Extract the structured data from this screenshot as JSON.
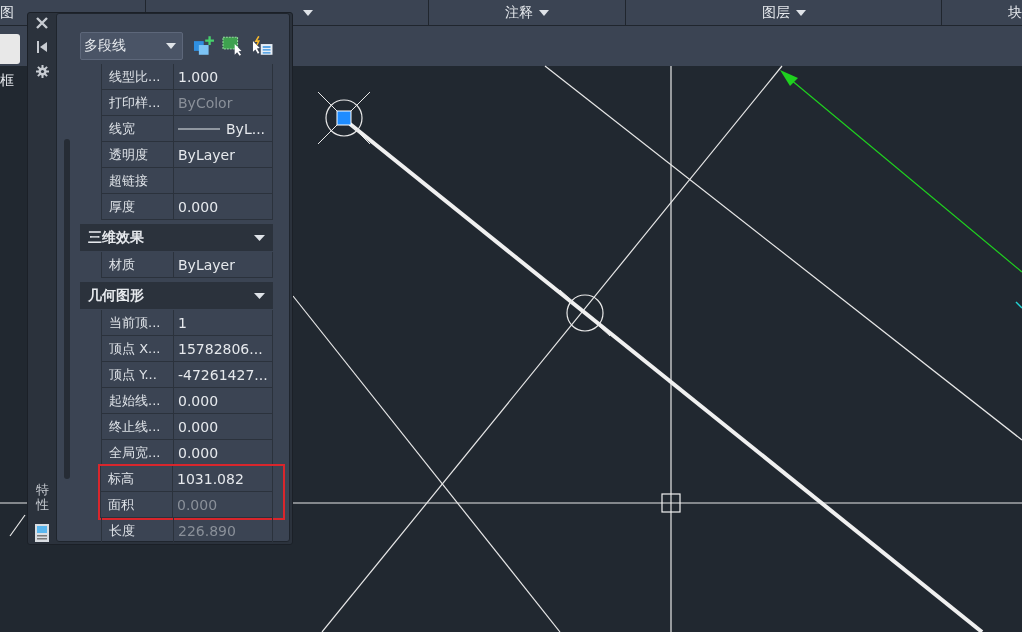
{
  "ribbon_panels": [
    {
      "kind": "label",
      "label": "图"
    },
    {
      "kind": "arrow"
    },
    {
      "kind": "menu",
      "label": "注释"
    },
    {
      "kind": "menu",
      "label": "图层"
    },
    {
      "kind": "label",
      "label": "块"
    }
  ],
  "left_palette": {
    "label": "框"
  },
  "properties_palette": {
    "title": "特性",
    "object_type": "多段线",
    "groups": [
      {
        "rows": [
          {
            "label": "线型比...",
            "value": "1.000",
            "disabled": false,
            "highlighted": false
          },
          {
            "label": "打印样...",
            "value": "ByColor",
            "disabled": true,
            "highlighted": false
          },
          {
            "label": "线宽",
            "value": "ByL...",
            "kind": "lineweight",
            "disabled": false,
            "highlighted": false
          },
          {
            "label": "透明度",
            "value": "ByLayer",
            "disabled": false,
            "highlighted": false
          },
          {
            "label": "超链接",
            "highlighted": false
          },
          {
            "label": "厚度",
            "value": "0.000",
            "disabled": false,
            "highlighted": false
          }
        ]
      },
      {
        "title": "三维效果",
        "expanded": true,
        "rows": [
          {
            "label": "材质",
            "value": "ByLayer",
            "disabled": false,
            "highlighted": false
          }
        ]
      },
      {
        "title": "几何图形",
        "expanded": true,
        "rows": [
          {
            "label": "当前顶...",
            "value": "1",
            "disabled": false,
            "highlighted": false
          },
          {
            "label": "顶点 X...",
            "value": "15782806...",
            "disabled": false,
            "highlighted": false
          },
          {
            "label": "顶点 Y...",
            "value": "-47261427...",
            "disabled": false,
            "highlighted": false
          },
          {
            "label": "起始线...",
            "value": "0.000",
            "disabled": false,
            "highlighted": false
          },
          {
            "label": "终止线...",
            "value": "0.000",
            "disabled": false,
            "highlighted": false
          },
          {
            "label": "全局宽...",
            "value": "0.000",
            "disabled": false,
            "highlighted": false
          },
          {
            "label": "标高",
            "value": "1031.082",
            "disabled": false,
            "highlighted": true
          },
          {
            "label": "面积",
            "value": "0.000",
            "disabled": true,
            "highlighted": true
          },
          {
            "label": "长度",
            "value": "226.890",
            "disabled": true,
            "highlighted": false
          }
        ]
      }
    ]
  }
}
